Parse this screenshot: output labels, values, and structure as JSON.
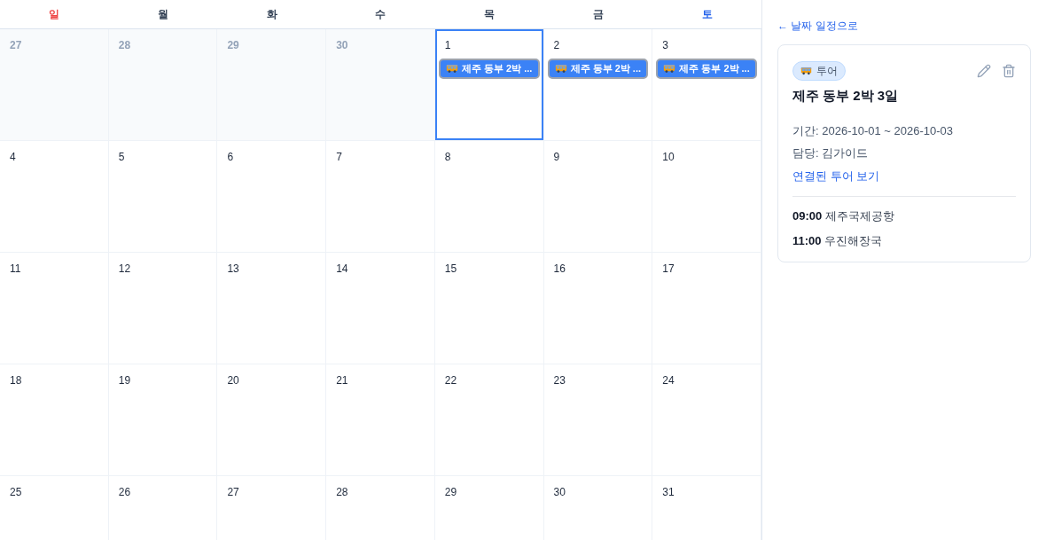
{
  "weekdays": [
    {
      "label": "일",
      "kind": "sunday"
    },
    {
      "label": "월",
      "kind": "weekday"
    },
    {
      "label": "화",
      "kind": "weekday"
    },
    {
      "label": "수",
      "kind": "weekday"
    },
    {
      "label": "목",
      "kind": "weekday"
    },
    {
      "label": "금",
      "kind": "weekday"
    },
    {
      "label": "토",
      "kind": "saturday"
    }
  ],
  "weeks": [
    [
      {
        "day": "27",
        "outside": true,
        "selected": false
      },
      {
        "day": "28",
        "outside": true,
        "selected": false
      },
      {
        "day": "29",
        "outside": true,
        "selected": false
      },
      {
        "day": "30",
        "outside": true,
        "selected": false
      },
      {
        "day": "1",
        "outside": false,
        "selected": true,
        "events": [
          "제주 동부 2박 ..."
        ]
      },
      {
        "day": "2",
        "outside": false,
        "selected": false,
        "events": [
          "제주 동부 2박 ..."
        ]
      },
      {
        "day": "3",
        "outside": false,
        "selected": false,
        "events": [
          "제주 동부 2박 ..."
        ]
      }
    ],
    [
      {
        "day": "4",
        "outside": false,
        "selected": false
      },
      {
        "day": "5",
        "outside": false,
        "selected": false
      },
      {
        "day": "6",
        "outside": false,
        "selected": false
      },
      {
        "day": "7",
        "outside": false,
        "selected": false
      },
      {
        "day": "8",
        "outside": false,
        "selected": false
      },
      {
        "day": "9",
        "outside": false,
        "selected": false
      },
      {
        "day": "10",
        "outside": false,
        "selected": false
      }
    ],
    [
      {
        "day": "11",
        "outside": false,
        "selected": false
      },
      {
        "day": "12",
        "outside": false,
        "selected": false
      },
      {
        "day": "13",
        "outside": false,
        "selected": false
      },
      {
        "day": "14",
        "outside": false,
        "selected": false
      },
      {
        "day": "15",
        "outside": false,
        "selected": false
      },
      {
        "day": "16",
        "outside": false,
        "selected": false
      },
      {
        "day": "17",
        "outside": false,
        "selected": false
      }
    ],
    [
      {
        "day": "18",
        "outside": false,
        "selected": false
      },
      {
        "day": "19",
        "outside": false,
        "selected": false
      },
      {
        "day": "20",
        "outside": false,
        "selected": false
      },
      {
        "day": "21",
        "outside": false,
        "selected": false
      },
      {
        "day": "22",
        "outside": false,
        "selected": false
      },
      {
        "day": "23",
        "outside": false,
        "selected": false
      },
      {
        "day": "24",
        "outside": false,
        "selected": false
      }
    ],
    [
      {
        "day": "25",
        "outside": false,
        "selected": false
      },
      {
        "day": "26",
        "outside": false,
        "selected": false
      },
      {
        "day": "27",
        "outside": false,
        "selected": false
      },
      {
        "day": "28",
        "outside": false,
        "selected": false
      },
      {
        "day": "29",
        "outside": false,
        "selected": false
      },
      {
        "day": "30",
        "outside": false,
        "selected": false
      },
      {
        "day": "31",
        "outside": false,
        "selected": false
      }
    ]
  ],
  "detail": {
    "back_link": "← 날짜 일정으로",
    "badge": "투어",
    "title": "제주 동부 2박 3일",
    "period": "기간: 2026-10-01 ~ 2026-10-03",
    "manager": "담당: 김가이드",
    "tour_link": "연결된 투어 보기",
    "schedule": [
      {
        "time": "09:00",
        "place": "제주국제공항"
      },
      {
        "time": "11:00",
        "place": "우진해장국"
      }
    ]
  }
}
